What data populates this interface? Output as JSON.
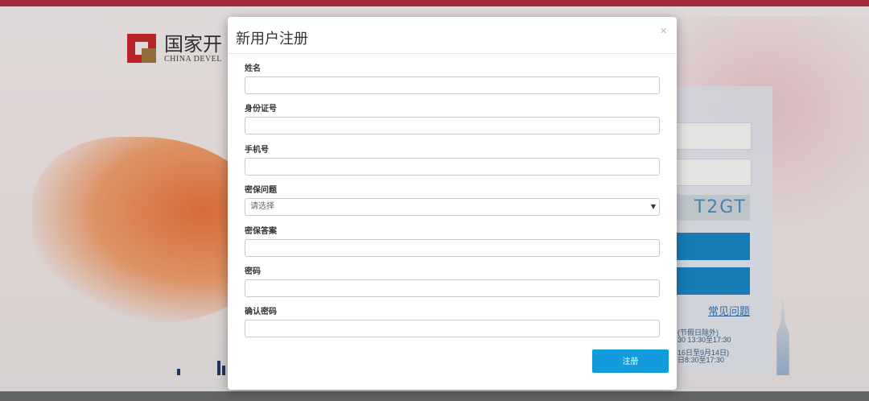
{
  "background": {
    "logo": {
      "name_cn": "国家开",
      "name_en": "CHINA DEVEL"
    },
    "captcha_text": "T2GT",
    "faq_link": "常见问题",
    "notes": [
      "(节假日除外)",
      "30   13:30至17:30",
      "16日至9月14日)",
      "日8:30至17:30"
    ]
  },
  "modal": {
    "title": "新用户注册",
    "close_symbol": "×",
    "fields": [
      {
        "label": "姓名",
        "value": "",
        "placeholder": ""
      },
      {
        "label": "身份证号",
        "value": "",
        "placeholder": ""
      },
      {
        "label": "手机号",
        "value": "",
        "placeholder": ""
      },
      {
        "label": "密保问题",
        "type": "select",
        "selected": "请选择"
      },
      {
        "label": "密保答案",
        "value": "",
        "placeholder": ""
      },
      {
        "label": "密码",
        "value": "",
        "placeholder": ""
      },
      {
        "label": "确认密码",
        "value": "",
        "placeholder": ""
      }
    ],
    "submit_label": "注册"
  },
  "colors": {
    "brand_red": "#c8262e",
    "primary_button": "#139bde",
    "top_bar": "#b0303c"
  },
  "icons": {
    "close": "close-icon",
    "select_caret": "caret-down-icon"
  }
}
